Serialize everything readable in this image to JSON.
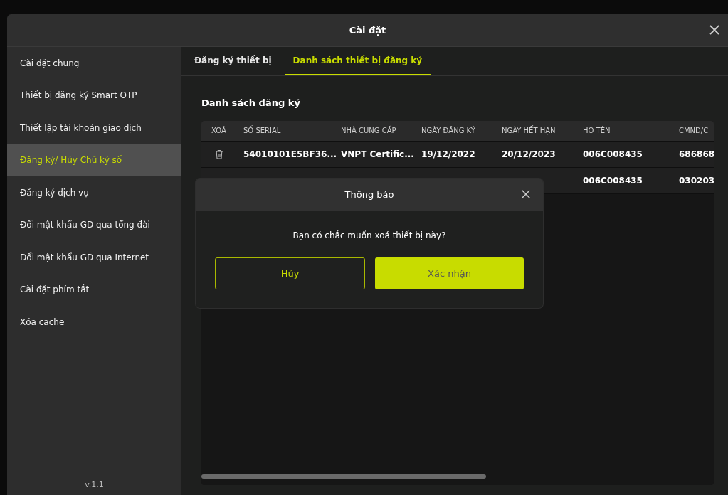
{
  "window": {
    "title": "Cài đặt"
  },
  "sidebar": {
    "items": [
      {
        "label": "Cài đặt chung",
        "selected": false
      },
      {
        "label": "Thiết bị đăng ký Smart OTP",
        "selected": false
      },
      {
        "label": "Thiết lập tài khoản giao dịch",
        "selected": false
      },
      {
        "label": "Đăng ký/ Hủy Chữ ký số",
        "selected": true
      },
      {
        "label": "Đăng ký dịch vụ",
        "selected": false
      },
      {
        "label": "Đổi mật khẩu GD qua tổng đài",
        "selected": false
      },
      {
        "label": "Đổi mật khẩu GD qua Internet",
        "selected": false
      },
      {
        "label": "Cài đặt phím tắt",
        "selected": false
      },
      {
        "label": "Xóa cache",
        "selected": false
      }
    ],
    "version": "v.1.1"
  },
  "tabs": [
    {
      "label": "Đăng ký thiết bị",
      "selected": false
    },
    {
      "label": "Danh sách thiết bị đăng ký",
      "selected": true
    }
  ],
  "section_title": "Danh sách đăng ký",
  "table": {
    "columns": [
      "XOÁ",
      "SỐ SERIAL",
      "NHÀ CUNG CẤP",
      "NGÀY ĐĂNG KÝ",
      "NGÀY HẾT HẠN",
      "HỌ TÊN",
      "CMND/C"
    ],
    "rows": [
      {
        "delete_icon": true,
        "cells": [
          "",
          "54010101E5BF36...",
          "VNPT Certific...",
          "19/12/2022",
          "20/12/2023",
          "006C008435",
          "686868"
        ]
      },
      {
        "delete_icon": false,
        "cells": [
          "",
          "",
          "",
          "",
          "",
          "006C008435",
          "030203"
        ]
      }
    ]
  },
  "dialog": {
    "title": "Thông báo",
    "message": "Bạn có chắc muốn xoá thiết bị này?",
    "buttons": [
      {
        "label": "Hủy",
        "kind": "outline"
      },
      {
        "label": "Xác nhận",
        "kind": "primary"
      }
    ]
  }
}
